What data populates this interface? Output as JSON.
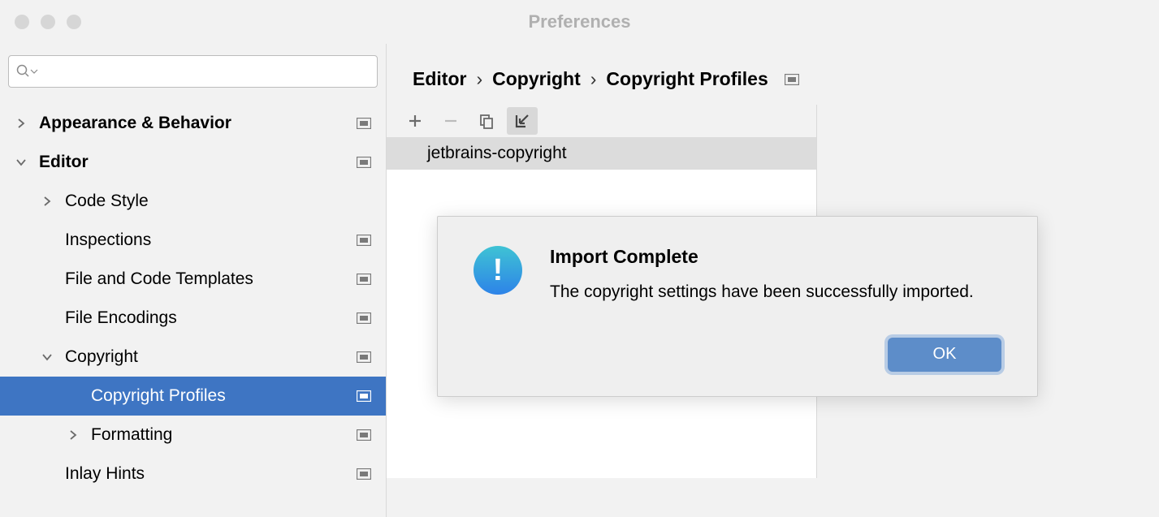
{
  "window": {
    "title": "Preferences"
  },
  "search": {
    "placeholder": ""
  },
  "tree": {
    "items": [
      {
        "label": "Appearance & Behavior",
        "level": 0,
        "bold": true,
        "chevron": "right",
        "badge": true,
        "selected": false
      },
      {
        "label": "Editor",
        "level": 0,
        "bold": true,
        "chevron": "down",
        "badge": true,
        "selected": false
      },
      {
        "label": "Code Style",
        "level": 1,
        "bold": false,
        "chevron": "right",
        "badge": false,
        "selected": false
      },
      {
        "label": "Inspections",
        "level": 1,
        "bold": false,
        "chevron": "none",
        "badge": true,
        "selected": false
      },
      {
        "label": "File and Code Templates",
        "level": 1,
        "bold": false,
        "chevron": "none",
        "badge": true,
        "selected": false
      },
      {
        "label": "File Encodings",
        "level": 1,
        "bold": false,
        "chevron": "none",
        "badge": true,
        "selected": false
      },
      {
        "label": "Copyright",
        "level": 1,
        "bold": false,
        "chevron": "down",
        "badge": true,
        "selected": false
      },
      {
        "label": "Copyright Profiles",
        "level": 2,
        "bold": false,
        "chevron": "none",
        "badge": true,
        "selected": true
      },
      {
        "label": "Formatting",
        "level": 2,
        "bold": false,
        "chevron": "right",
        "badge": true,
        "selected": false
      },
      {
        "label": "Inlay Hints",
        "level": 1,
        "bold": false,
        "chevron": "none",
        "badge": true,
        "selected": false
      }
    ]
  },
  "breadcrumb": {
    "items": [
      "Editor",
      "Copyright",
      "Copyright Profiles"
    ]
  },
  "toolbar": {
    "add": "add",
    "remove": "remove",
    "copy": "copy",
    "import": "import"
  },
  "profiles": {
    "items": [
      {
        "name": "jetbrains-copyright"
      }
    ]
  },
  "dialog": {
    "title": "Import Complete",
    "message": "The copyright settings have been successfully imported.",
    "ok": "OK"
  }
}
